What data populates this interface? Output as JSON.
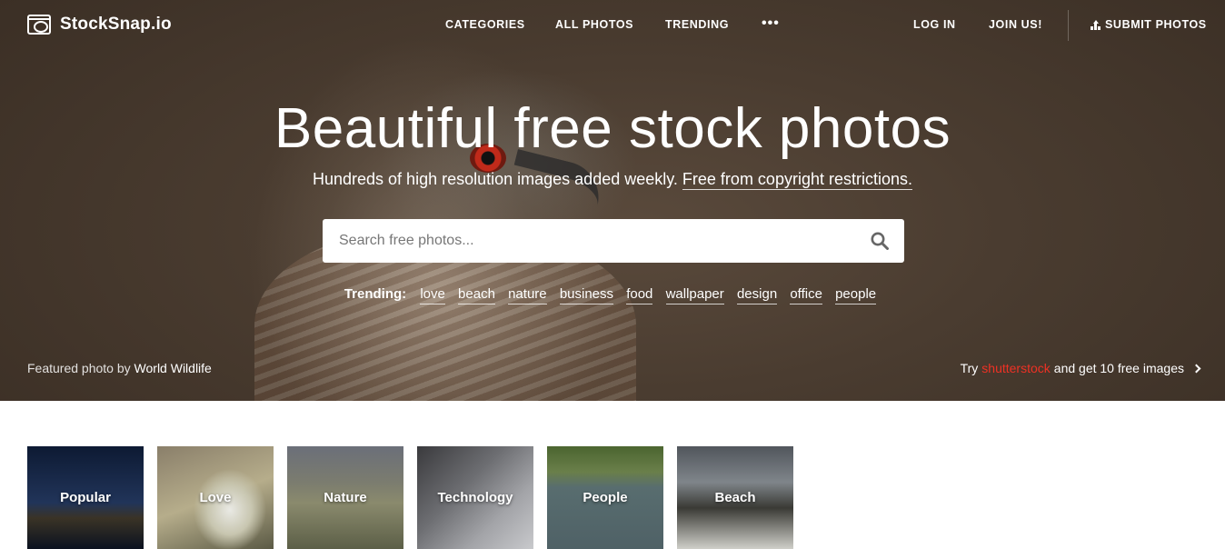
{
  "brand": {
    "name": "StockSnap.io"
  },
  "nav": {
    "categories": "CATEGORIES",
    "all_photos": "ALL PHOTOS",
    "trending": "TRENDING",
    "more": "•••",
    "login": "LOG IN",
    "join": "JOIN US!",
    "submit": "SUBMIT PHOTOS"
  },
  "hero": {
    "headline": "Beautiful free stock photos",
    "subline": "Hundreds of high resolution images added weekly.",
    "subline_link": "Free from copyright restrictions.",
    "search_placeholder": "Search free photos...",
    "trending_label": "Trending:",
    "trending_tags": [
      "love",
      "beach",
      "nature",
      "business",
      "food",
      "wallpaper",
      "design",
      "office",
      "people"
    ],
    "featured_prefix": "Featured photo by",
    "featured_author": "World Wildlife",
    "promo_try": "Try",
    "promo_brand": "shutterstock",
    "promo_rest": "and get 10 free images"
  },
  "categories": [
    "Popular",
    "Love",
    "Nature",
    "Technology",
    "People",
    "Beach"
  ],
  "colors": {
    "promo_brand": "#ee3124",
    "hero_bg": "#4a3c30",
    "text_on_hero": "#ffffff"
  }
}
